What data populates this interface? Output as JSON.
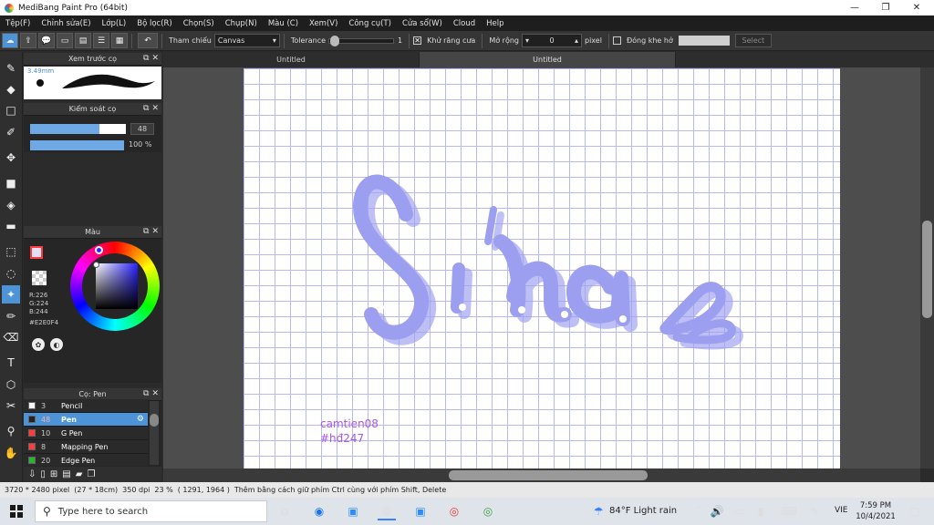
{
  "window": {
    "title": "MediBang Paint Pro (64bit)",
    "minimize_glyph": "—",
    "restore_glyph": "❐",
    "close_glyph": "✕"
  },
  "menu": [
    "Tệp(F)",
    "Chỉnh sửa(E)",
    "Lớp(L)",
    "Bộ lọc(R)",
    "Chọn(S)",
    "Chụp(N)",
    "Màu (C)",
    "Xem(V)",
    "Công cụ(T)",
    "Cửa sổ(W)",
    "Cloud",
    "Help"
  ],
  "toolbar": {
    "tham_chieu_label": "Tham chiếu",
    "canvas_value": "Canvas",
    "tolerance_label": "Tolerance",
    "tolerance_value": "1",
    "tolerance_fraction": 0.02,
    "antialias_label": "Khử răng cưa",
    "antialias_checked": true,
    "expand_label": "Mở rộng",
    "expand_value": "0",
    "pixel_label": "pixel",
    "close_gap_label": "Đóng khe hở",
    "close_gap_checked": false,
    "select_label": "Select"
  },
  "tabs": [
    "Untitled",
    "Untitled"
  ],
  "brush_preview": {
    "title": "Xem trước cọ",
    "size_label": "3.49mm"
  },
  "brush_control": {
    "title": "Kiểm soát cọ",
    "size_value": "48",
    "size_fraction": 0.72,
    "opacity_value": "100 %",
    "opacity_fraction": 1.0
  },
  "color": {
    "title": "Màu",
    "r": "R:226",
    "g": "G:224",
    "b": "B:244",
    "hex": "#E2E0F4",
    "primary": "#e2e0f4",
    "accent": "#ff3b3b"
  },
  "brush_list": {
    "title": "Cọ: Pen",
    "items": [
      {
        "size": "3",
        "name": "Pencil",
        "color": "#f5f5f5"
      },
      {
        "size": "48",
        "name": "Pen",
        "color": "#222222"
      },
      {
        "size": "10",
        "name": "G Pen",
        "color": "#ff3b3b"
      },
      {
        "size": "8",
        "name": "Mapping Pen",
        "color": "#ff3b3b"
      },
      {
        "size": "20",
        "name": "Edge Pen",
        "color": "#29b52f"
      }
    ]
  },
  "canvas": {
    "signature_line1": "camtien08",
    "signature_line2": "#hđ247",
    "lettering": "Sửa",
    "lettering_color": "#9c9ef0"
  },
  "status": {
    "size": "3720 * 2480 pixel",
    "physical": "(27 * 18cm)",
    "dpi": "350 dpi",
    "zoom": "23 %",
    "cursor": "( 1291, 1964 )",
    "hint": "Thêm bằng cách giữ phím Ctrl cùng với phím Shift, Delete"
  },
  "taskbar": {
    "search_placeholder": "Type here to search",
    "weather": "84°F  Light rain",
    "lang": "VIE",
    "time": "7:59 PM",
    "date": "10/4/2021"
  }
}
